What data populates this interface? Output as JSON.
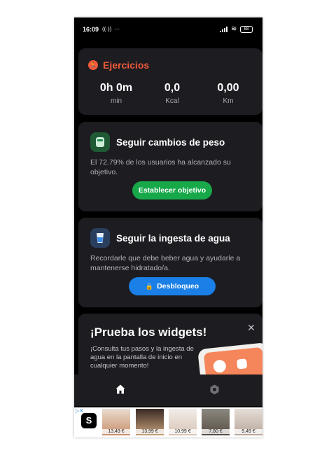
{
  "status": {
    "time": "16:09",
    "battery": "88"
  },
  "exercises": {
    "title": "Ejercicios",
    "stats": [
      {
        "value": "0h 0m",
        "unit": "min"
      },
      {
        "value": "0,0",
        "unit": "Kcal"
      },
      {
        "value": "0,00",
        "unit": "Km"
      }
    ]
  },
  "weight": {
    "title": "Seguir cambios de peso",
    "desc": "El 72.79% de los usuarios ha alcanzado su objetivo.",
    "button": "Establecer objetivo"
  },
  "water": {
    "title": "Seguir la ingesta de agua",
    "desc": "Recordarle que debe beber agua y ayudarle a mantenerse hidratado/a.",
    "button": "Desbloqueo"
  },
  "promo": {
    "title": "¡Prueba los widgets!",
    "desc": "¡Consulta tus pasos y la ingesta de agua en la pantalla de inicio en cualquier momento!"
  },
  "ad": {
    "prices": [
      "13,49 €",
      "13,99 €",
      "10,99 €",
      "7,80 €",
      "9,49 €"
    ]
  },
  "colors": {
    "accent_orange": "#ef5a3a",
    "green": "#17a84a",
    "blue": "#1a7fe6",
    "card": "#1d1c21"
  }
}
